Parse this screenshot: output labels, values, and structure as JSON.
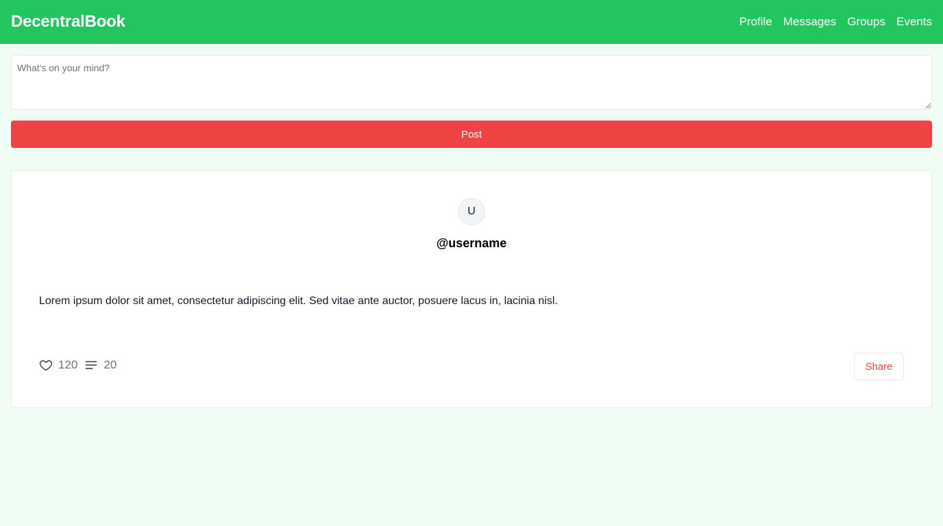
{
  "header": {
    "brand": "DecentralBook",
    "nav": [
      "Profile",
      "Messages",
      "Groups",
      "Events"
    ]
  },
  "composer": {
    "placeholder": "What's on your mind?",
    "value": "",
    "post_label": "Post"
  },
  "post": {
    "avatar_initial": "U",
    "username": "@username",
    "body": "Lorem ipsum dolor sit amet, consectetur adipiscing elit. Sed vitae ante auctor, posuere lacus in, lacinia nisl.",
    "likes": "120",
    "comments": "20",
    "share_label": "Share",
    "icons": {
      "like": "heart-icon",
      "comment": "lines-icon"
    }
  },
  "colors": {
    "header": "#22c55e",
    "background": "#f0fdf4",
    "accent": "#ef4444",
    "muted_text": "#6b7280"
  }
}
